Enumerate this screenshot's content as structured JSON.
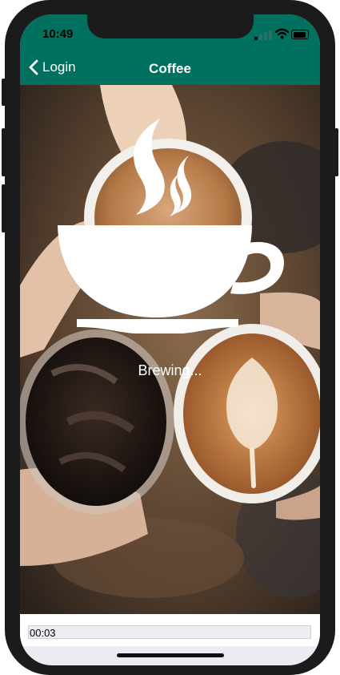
{
  "status_bar": {
    "time": "10:49",
    "signal_icon": "signal-bars-icon",
    "wifi_icon": "wifi-icon",
    "battery_icon": "battery-icon"
  },
  "nav": {
    "back_label": "Login",
    "back_icon": "chevron-left-icon",
    "title": "Coffee",
    "bar_color": "#00705f"
  },
  "main": {
    "background_image": "coffee-cups-cheers-photo",
    "overlay_icon": "coffee-cup-steam-icon",
    "status_text": "Brewing..."
  },
  "timer": {
    "elapsed": "00:03"
  }
}
